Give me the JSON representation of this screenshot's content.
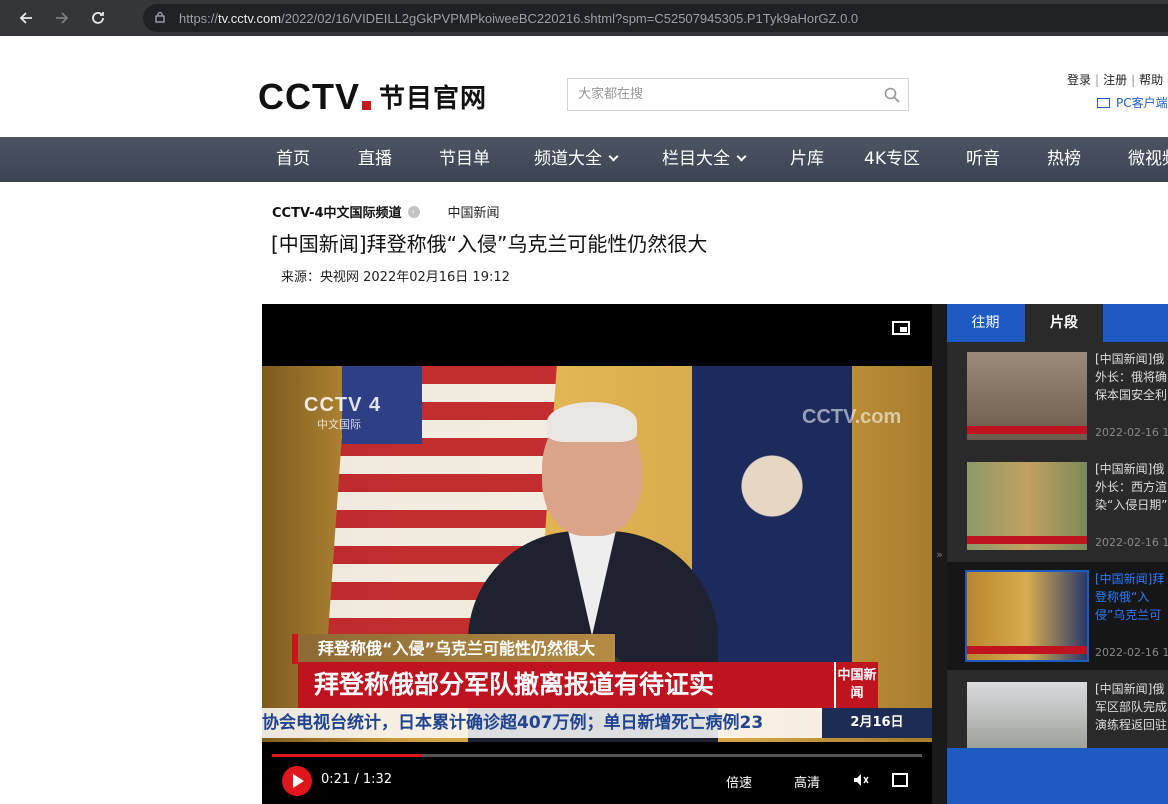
{
  "browser": {
    "url_prefix": "https://",
    "url_host": "tv.cctv.com",
    "url_path": "/2022/02/16/VIDEILL2gGkPVPMPkoiweeBC220216.shtml?spm=C52507945305.P1Tyk9aHorGZ.0.0"
  },
  "header": {
    "logo_cctv": "CCTV",
    "logo_text": "节目官网",
    "search_placeholder": "大家都在搜",
    "login": "登录",
    "register": "注册",
    "help": "帮助",
    "pc_client": "PC客户端"
  },
  "nav": {
    "items": [
      {
        "label": "首页"
      },
      {
        "label": "直播"
      },
      {
        "label": "节目单"
      },
      {
        "label": "频道大全"
      },
      {
        "label": "栏目大全"
      },
      {
        "label": "片库"
      },
      {
        "label": "4K专区"
      },
      {
        "label": "听音"
      },
      {
        "label": "热榜"
      },
      {
        "label": "微视频"
      }
    ]
  },
  "article": {
    "channel": "CCTV-4中文国际频道",
    "column": "中国新闻",
    "title": "[中国新闻]拜登称俄“入侵”乌克兰可能性仍然很大",
    "meta": "来源：央视网 2022年02月16日 19:12"
  },
  "player": {
    "bug_channel": "CCTV 4",
    "bug_sub": "中文国际",
    "watermark": "CCTV.com",
    "lower_third_small": "拜登称俄“入侵”乌克兰可能性仍然很大",
    "lower_third_main": "拜登称俄部分军队撤离报道有待证实",
    "news_badge": "中国新闻",
    "ticker": "协会电视台统计，日本累计确诊超407万例；单日新增死亡病例23",
    "date_badge": "2月16日",
    "time_current": "0:21",
    "time_total": "1:32",
    "progress_fraction": 0.23,
    "speed_label": "倍速",
    "quality_label": "高清"
  },
  "side_panel": {
    "tabs": [
      {
        "label": "往期"
      },
      {
        "label": "片段"
      }
    ],
    "clips": [
      {
        "title": "[中国新闻]俄外长：俄将确保本国安全利益，呼吁西方认清形势与西方继续",
        "date": "2022-02-16 1"
      },
      {
        "title": "[中国新闻]俄外长：西方渲染“入侵日期”",
        "date": "2022-02-16 1"
      },
      {
        "title": "[中国新闻]拜登称俄“入侵”乌克兰可能性仍然很大",
        "date": "2022-02-16 1"
      },
      {
        "title": "[中国新闻]俄军区部队完成演练程返回驻地",
        "date": ""
      }
    ]
  },
  "colors": {
    "nav_bg": "#454d5c",
    "brand_red": "#c8161d",
    "panel_blue": "#1d5bc3"
  }
}
